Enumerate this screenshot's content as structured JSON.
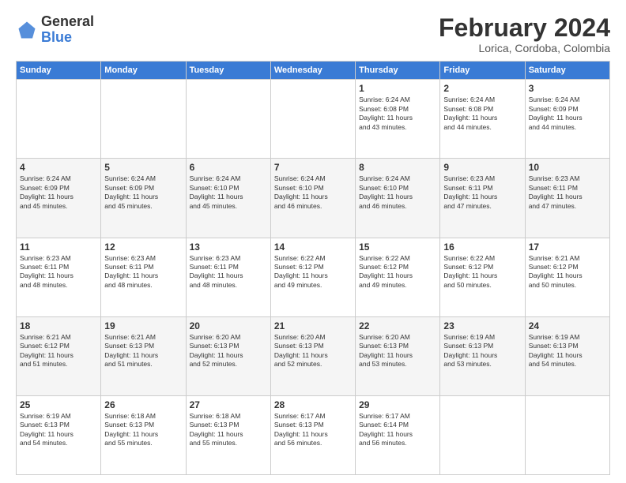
{
  "logo": {
    "general": "General",
    "blue": "Blue"
  },
  "header": {
    "month": "February 2024",
    "location": "Lorica, Cordoba, Colombia"
  },
  "weekdays": [
    "Sunday",
    "Monday",
    "Tuesday",
    "Wednesday",
    "Thursday",
    "Friday",
    "Saturday"
  ],
  "weeks": [
    [
      {
        "day": "",
        "info": ""
      },
      {
        "day": "",
        "info": ""
      },
      {
        "day": "",
        "info": ""
      },
      {
        "day": "",
        "info": ""
      },
      {
        "day": "1",
        "info": "Sunrise: 6:24 AM\nSunset: 6:08 PM\nDaylight: 11 hours\nand 43 minutes."
      },
      {
        "day": "2",
        "info": "Sunrise: 6:24 AM\nSunset: 6:08 PM\nDaylight: 11 hours\nand 44 minutes."
      },
      {
        "day": "3",
        "info": "Sunrise: 6:24 AM\nSunset: 6:09 PM\nDaylight: 11 hours\nand 44 minutes."
      }
    ],
    [
      {
        "day": "4",
        "info": "Sunrise: 6:24 AM\nSunset: 6:09 PM\nDaylight: 11 hours\nand 45 minutes."
      },
      {
        "day": "5",
        "info": "Sunrise: 6:24 AM\nSunset: 6:09 PM\nDaylight: 11 hours\nand 45 minutes."
      },
      {
        "day": "6",
        "info": "Sunrise: 6:24 AM\nSunset: 6:10 PM\nDaylight: 11 hours\nand 45 minutes."
      },
      {
        "day": "7",
        "info": "Sunrise: 6:24 AM\nSunset: 6:10 PM\nDaylight: 11 hours\nand 46 minutes."
      },
      {
        "day": "8",
        "info": "Sunrise: 6:24 AM\nSunset: 6:10 PM\nDaylight: 11 hours\nand 46 minutes."
      },
      {
        "day": "9",
        "info": "Sunrise: 6:23 AM\nSunset: 6:11 PM\nDaylight: 11 hours\nand 47 minutes."
      },
      {
        "day": "10",
        "info": "Sunrise: 6:23 AM\nSunset: 6:11 PM\nDaylight: 11 hours\nand 47 minutes."
      }
    ],
    [
      {
        "day": "11",
        "info": "Sunrise: 6:23 AM\nSunset: 6:11 PM\nDaylight: 11 hours\nand 48 minutes."
      },
      {
        "day": "12",
        "info": "Sunrise: 6:23 AM\nSunset: 6:11 PM\nDaylight: 11 hours\nand 48 minutes."
      },
      {
        "day": "13",
        "info": "Sunrise: 6:23 AM\nSunset: 6:11 PM\nDaylight: 11 hours\nand 48 minutes."
      },
      {
        "day": "14",
        "info": "Sunrise: 6:22 AM\nSunset: 6:12 PM\nDaylight: 11 hours\nand 49 minutes."
      },
      {
        "day": "15",
        "info": "Sunrise: 6:22 AM\nSunset: 6:12 PM\nDaylight: 11 hours\nand 49 minutes."
      },
      {
        "day": "16",
        "info": "Sunrise: 6:22 AM\nSunset: 6:12 PM\nDaylight: 11 hours\nand 50 minutes."
      },
      {
        "day": "17",
        "info": "Sunrise: 6:21 AM\nSunset: 6:12 PM\nDaylight: 11 hours\nand 50 minutes."
      }
    ],
    [
      {
        "day": "18",
        "info": "Sunrise: 6:21 AM\nSunset: 6:12 PM\nDaylight: 11 hours\nand 51 minutes."
      },
      {
        "day": "19",
        "info": "Sunrise: 6:21 AM\nSunset: 6:13 PM\nDaylight: 11 hours\nand 51 minutes."
      },
      {
        "day": "20",
        "info": "Sunrise: 6:20 AM\nSunset: 6:13 PM\nDaylight: 11 hours\nand 52 minutes."
      },
      {
        "day": "21",
        "info": "Sunrise: 6:20 AM\nSunset: 6:13 PM\nDaylight: 11 hours\nand 52 minutes."
      },
      {
        "day": "22",
        "info": "Sunrise: 6:20 AM\nSunset: 6:13 PM\nDaylight: 11 hours\nand 53 minutes."
      },
      {
        "day": "23",
        "info": "Sunrise: 6:19 AM\nSunset: 6:13 PM\nDaylight: 11 hours\nand 53 minutes."
      },
      {
        "day": "24",
        "info": "Sunrise: 6:19 AM\nSunset: 6:13 PM\nDaylight: 11 hours\nand 54 minutes."
      }
    ],
    [
      {
        "day": "25",
        "info": "Sunrise: 6:19 AM\nSunset: 6:13 PM\nDaylight: 11 hours\nand 54 minutes."
      },
      {
        "day": "26",
        "info": "Sunrise: 6:18 AM\nSunset: 6:13 PM\nDaylight: 11 hours\nand 55 minutes."
      },
      {
        "day": "27",
        "info": "Sunrise: 6:18 AM\nSunset: 6:13 PM\nDaylight: 11 hours\nand 55 minutes."
      },
      {
        "day": "28",
        "info": "Sunrise: 6:17 AM\nSunset: 6:13 PM\nDaylight: 11 hours\nand 56 minutes."
      },
      {
        "day": "29",
        "info": "Sunrise: 6:17 AM\nSunset: 6:14 PM\nDaylight: 11 hours\nand 56 minutes."
      },
      {
        "day": "",
        "info": ""
      },
      {
        "day": "",
        "info": ""
      }
    ]
  ]
}
